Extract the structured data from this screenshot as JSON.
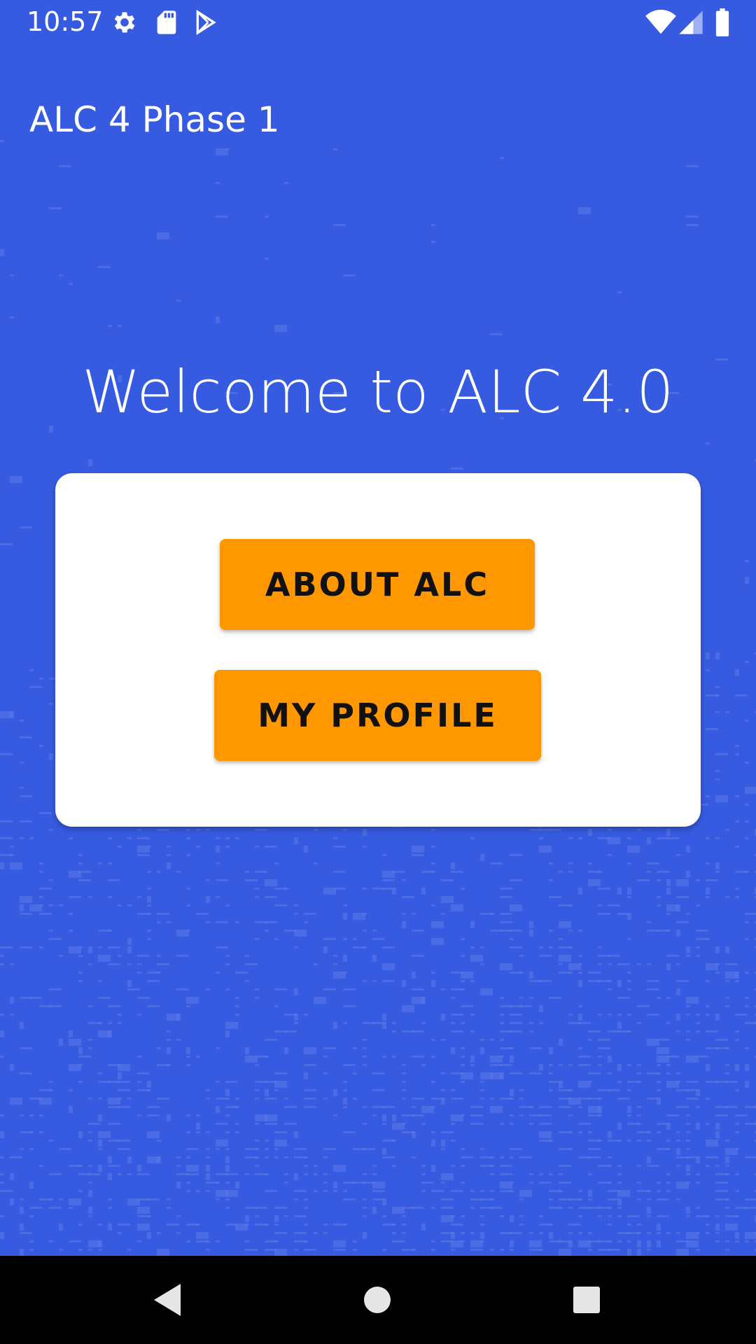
{
  "status_bar": {
    "time": "10:57",
    "icons_left": [
      "gear-icon",
      "sd-card-icon",
      "play-store-icon"
    ],
    "icons_right": [
      "wifi-icon",
      "signal-icon",
      "battery-icon"
    ]
  },
  "app_bar": {
    "title": "ALC 4 Phase 1"
  },
  "main": {
    "welcome": "Welcome to ALC 4.0",
    "buttons": {
      "about_label": "ABOUT ALC",
      "profile_label": "MY PROFILE"
    }
  },
  "nav_bar": {
    "items": [
      "back-icon",
      "home-icon",
      "recents-icon"
    ]
  },
  "colors": {
    "background": "#365BE0",
    "card": "#FFFFFF",
    "button": "#FF9800",
    "button_text": "#111111",
    "nav_bar": "#000000"
  }
}
